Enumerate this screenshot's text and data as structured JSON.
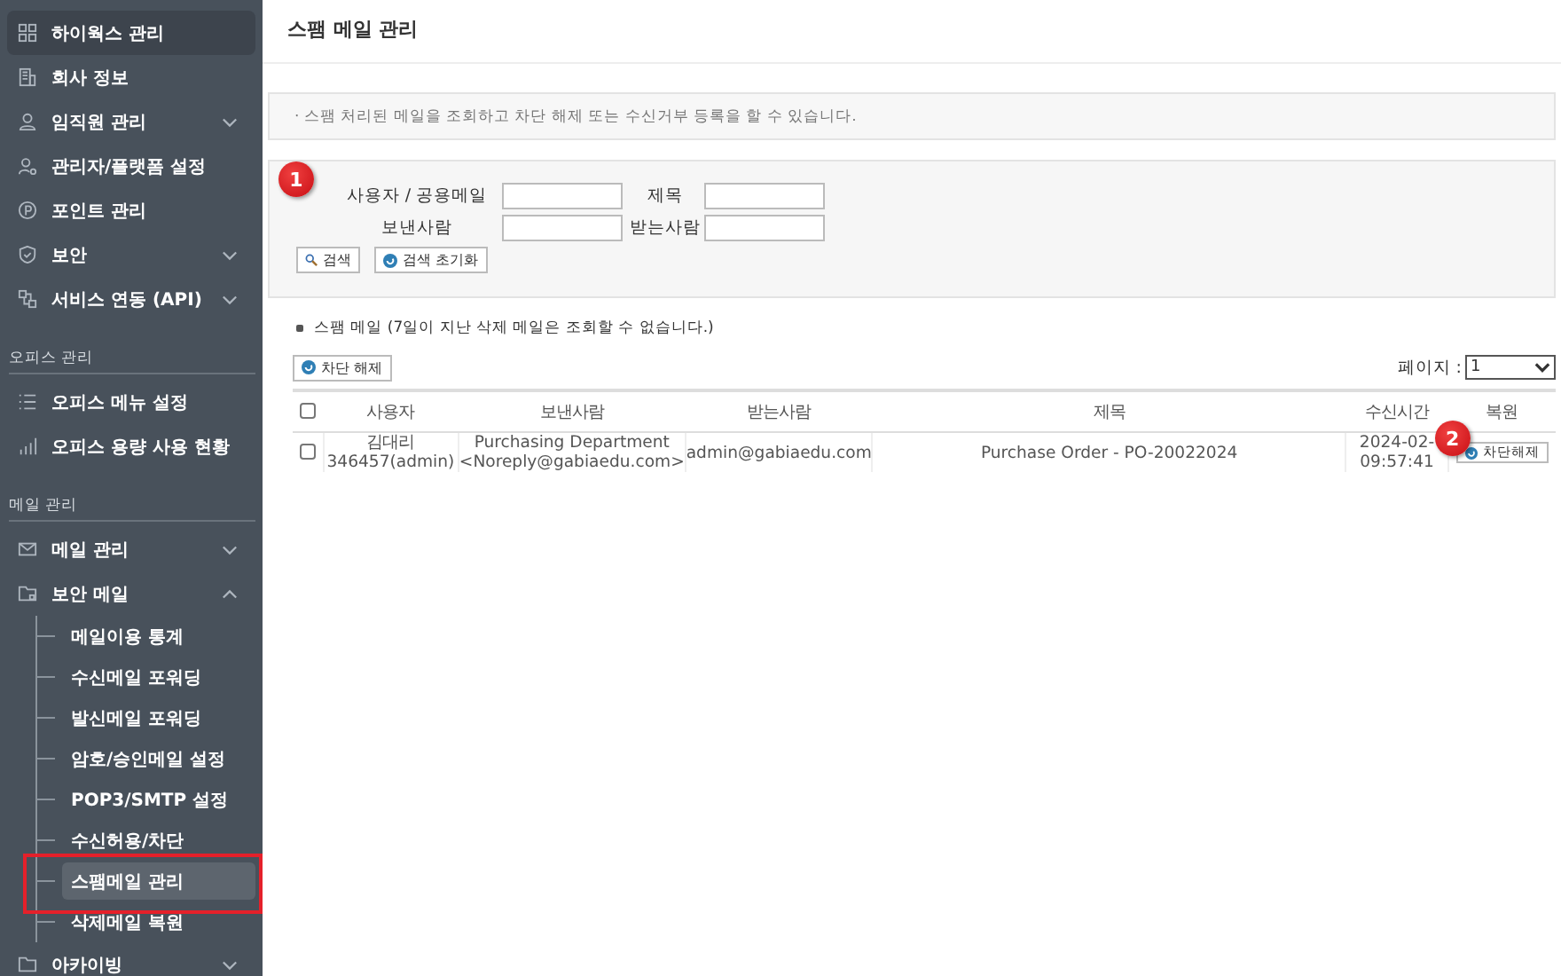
{
  "sidebar": {
    "items": [
      {
        "kind": "item",
        "label": "하이웍스 관리",
        "selected": true
      },
      {
        "kind": "item",
        "label": "회사 정보",
        "selected": false
      },
      {
        "kind": "item",
        "label": "임직원 관리",
        "selected": false,
        "expanded": false
      },
      {
        "kind": "item",
        "label": "관리자/플랫폼 설정",
        "selected": false
      },
      {
        "kind": "item",
        "label": "포인트 관리",
        "selected": false
      },
      {
        "kind": "item",
        "label": "보안",
        "selected": false,
        "expanded": false
      },
      {
        "kind": "item",
        "label": "서비스 연동 (API)",
        "selected": false,
        "expanded": false
      },
      {
        "kind": "section",
        "label": "오피스 관리"
      },
      {
        "kind": "item",
        "label": "오피스 메뉴 설정",
        "selected": false
      },
      {
        "kind": "item",
        "label": "오피스 용량 사용 현황",
        "selected": false
      },
      {
        "kind": "section",
        "label": "메일 관리"
      },
      {
        "kind": "item",
        "label": "메일 관리",
        "selected": false,
        "expanded": false
      },
      {
        "kind": "item",
        "label": "보안 메일",
        "selected": false,
        "expanded": true,
        "children": [
          {
            "label": "메일이용 통계",
            "selected": false,
            "highlighted": false
          },
          {
            "label": "수신메일 포워딩",
            "selected": false,
            "highlighted": false
          },
          {
            "label": "발신메일 포워딩",
            "selected": false,
            "highlighted": false
          },
          {
            "label": "암호/승인메일 설정",
            "selected": false,
            "highlighted": false
          },
          {
            "label": "POP3/SMTP 설정",
            "selected": false,
            "highlighted": false
          },
          {
            "label": "수신허용/차단",
            "selected": false,
            "highlighted": false
          },
          {
            "label": "스팸메일 관리",
            "selected": true,
            "highlighted": true
          },
          {
            "label": "삭제메일 복원",
            "selected": false,
            "highlighted": false
          }
        ]
      },
      {
        "kind": "item",
        "label": "아카이빙",
        "selected": false,
        "expanded": false
      }
    ]
  },
  "page_title": "스팸 메일 관리",
  "notice": "· 스팸 처리된 메일을 조회하고 차단 해제 또는 수신거부 등록을 할 수 있습니다.",
  "search_panel": {
    "callout": "1",
    "fields": [
      {
        "label": "사용자 / 공용메일"
      },
      {
        "label": "제목"
      },
      {
        "label": "보낸사람"
      },
      {
        "label": "받는사람"
      }
    ],
    "buttons": [
      {
        "kind": "search",
        "label": "검색"
      },
      {
        "kind": "reset",
        "label": "검색 초기화"
      }
    ]
  },
  "section_title": "스팸 메일 (7일이 지난 삭제 메일은 조회할 수 없습니다.)",
  "unblock_button": "차단 해제",
  "page_label": "페이지 :",
  "page_value": "1",
  "table": {
    "select_all_checked": false,
    "columns": [
      "사용자",
      "보낸사람",
      "받는사람",
      "제목",
      "수신시간",
      "복원"
    ],
    "rows": [
      {
        "checked": false,
        "user": [
          "김대리",
          "346457(admin)"
        ],
        "sender": [
          "Purchasing Department",
          "<Noreply@gabiaedu.com>"
        ],
        "recipient": "admin@gabiaedu.com",
        "subject": "Purchase Order - PO-20022024",
        "time": [
          "2024-02-",
          "09:57:41"
        ],
        "action": "차단해제",
        "callout": "2"
      }
    ]
  }
}
